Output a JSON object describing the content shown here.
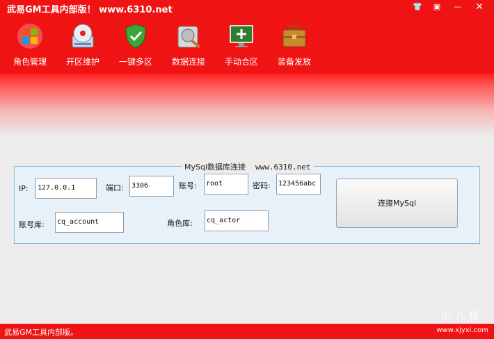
{
  "window": {
    "title": "武易GM工具内部版！  www.6310.net",
    "controls": [
      "skin-icon",
      "restore-icon",
      "minimize-icon",
      "close-icon"
    ]
  },
  "toolbar": {
    "items": [
      {
        "label": "角色管理",
        "icon": "windows-refresh-icon"
      },
      {
        "label": "开区维护",
        "icon": "disc-install-icon"
      },
      {
        "label": "一键多区",
        "icon": "shield-check-icon"
      },
      {
        "label": "数据连接",
        "icon": "hdd-tools-icon"
      },
      {
        "label": "手动合区",
        "icon": "monitor-plus-icon"
      },
      {
        "label": "装备发放",
        "icon": "briefcase-icon"
      }
    ]
  },
  "mysql_panel": {
    "title": "MySql数据库连接",
    "site": "www.6310.net",
    "ip_label": "IP:",
    "ip_value": "127.0.0.1",
    "port_label": "端口:",
    "port_value": "3306",
    "user_label": "账号:",
    "user_value": "root",
    "password_label": "密码:",
    "password_value": "123456abc",
    "account_db_label": "账号库:",
    "account_db_value": "cq_account",
    "role_db_label": "角色库:",
    "role_db_value": "cq_actor",
    "connect_button": "连接MySql"
  },
  "statusbar": {
    "text": "武易GM工具内部版。",
    "watermark": "小九楼",
    "watermark_url": "www.xjyxi.com"
  }
}
